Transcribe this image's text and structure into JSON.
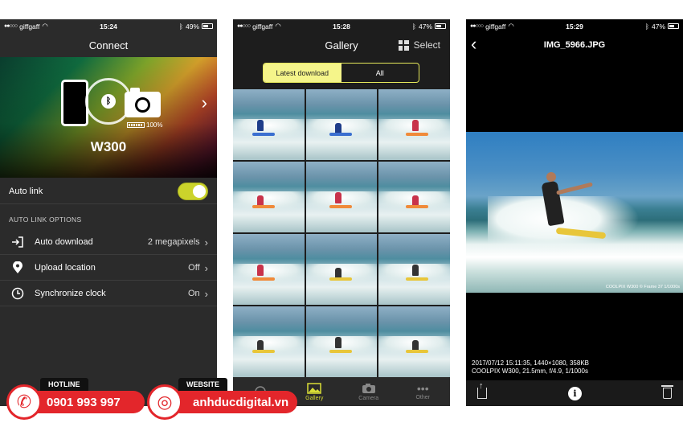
{
  "screen1": {
    "status": {
      "carrier": "giffgaff",
      "time": "15:24",
      "battery": "49%",
      "battery_level": 0.49
    },
    "title": "Connect",
    "camera_battery": "100%",
    "device": "W300",
    "auto_link": {
      "label": "Auto link",
      "on": true
    },
    "section": "AUTO LINK OPTIONS",
    "options": [
      {
        "label": "Auto download",
        "value": "2 megapixels",
        "icon": "download-icon"
      },
      {
        "label": "Upload location",
        "value": "Off",
        "icon": "location-pin-icon"
      },
      {
        "label": "Synchronize clock",
        "value": "On",
        "icon": "clock-icon"
      }
    ]
  },
  "screen2": {
    "status": {
      "carrier": "giffgaff",
      "time": "15:28",
      "battery": "47%",
      "battery_level": 0.47
    },
    "title": "Gallery",
    "select": "Select",
    "segments": [
      "Latest download",
      "All"
    ],
    "active_segment": 0,
    "tabs": [
      {
        "label": "",
        "icon": "headphones-icon"
      },
      {
        "label": "Gallery",
        "icon": "gallery-icon"
      },
      {
        "label": "Camera",
        "icon": "camera-icon"
      },
      {
        "label": "Other",
        "icon": "more-icon"
      }
    ]
  },
  "screen3": {
    "status": {
      "carrier": "giffgaff",
      "time": "15:29",
      "battery": "47%",
      "battery_level": 0.47
    },
    "title": "IMG_5966.JPG",
    "photo_credit": "COOLPIX W300 © Frame 37 1/1000s",
    "meta_line1": "2017/07/12 15:11:35, 1440×1080, 358KB",
    "meta_line2": "COOLPIX W300, 21.5mm, f/4.9, 1/1000s"
  },
  "banner": {
    "hotline_label": "HOTLINE",
    "hotline": "0901 993 997",
    "website_label": "WEBSITE",
    "website": "anhducdigital.vn"
  },
  "colors": {
    "accent": "#d9de36",
    "brand_red": "#e3262b"
  }
}
